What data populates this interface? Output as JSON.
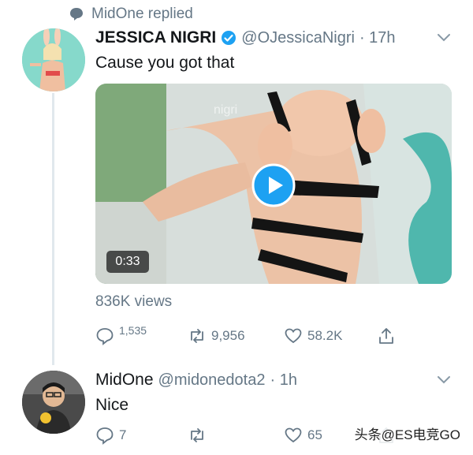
{
  "context": {
    "replied_text": "MidOne replied"
  },
  "tweet": {
    "author_name": "JESSICA NIGRI",
    "handle": "@OJessicaNigri",
    "time": "· 17h",
    "text": "Cause you got that",
    "media": {
      "duration": "0:33",
      "watermark_text": "nigri"
    },
    "views": "836K views",
    "actions": {
      "reply_count": "1,535",
      "retweet_count": "9,956",
      "like_count": "58.2K"
    }
  },
  "reply": {
    "author_name": "MidOne",
    "handle": "@midonedota2",
    "time": "· 1h",
    "text": "Nice",
    "actions": {
      "reply_count": "7",
      "retweet_count": "",
      "like_count": "65"
    }
  },
  "overlay": {
    "watermark": "头条@ES电竞GO"
  },
  "icons": {
    "context": "speech-bubble-icon",
    "verified": "verified-badge-icon",
    "more": "chevron-down-icon",
    "reply": "reply-icon",
    "retweet": "retweet-icon",
    "like": "heart-icon",
    "share": "share-icon",
    "play": "play-icon"
  },
  "colors": {
    "secondary_text": "#657786",
    "verified_blue": "#1da1f2",
    "play_blue": "#1da1f2"
  }
}
